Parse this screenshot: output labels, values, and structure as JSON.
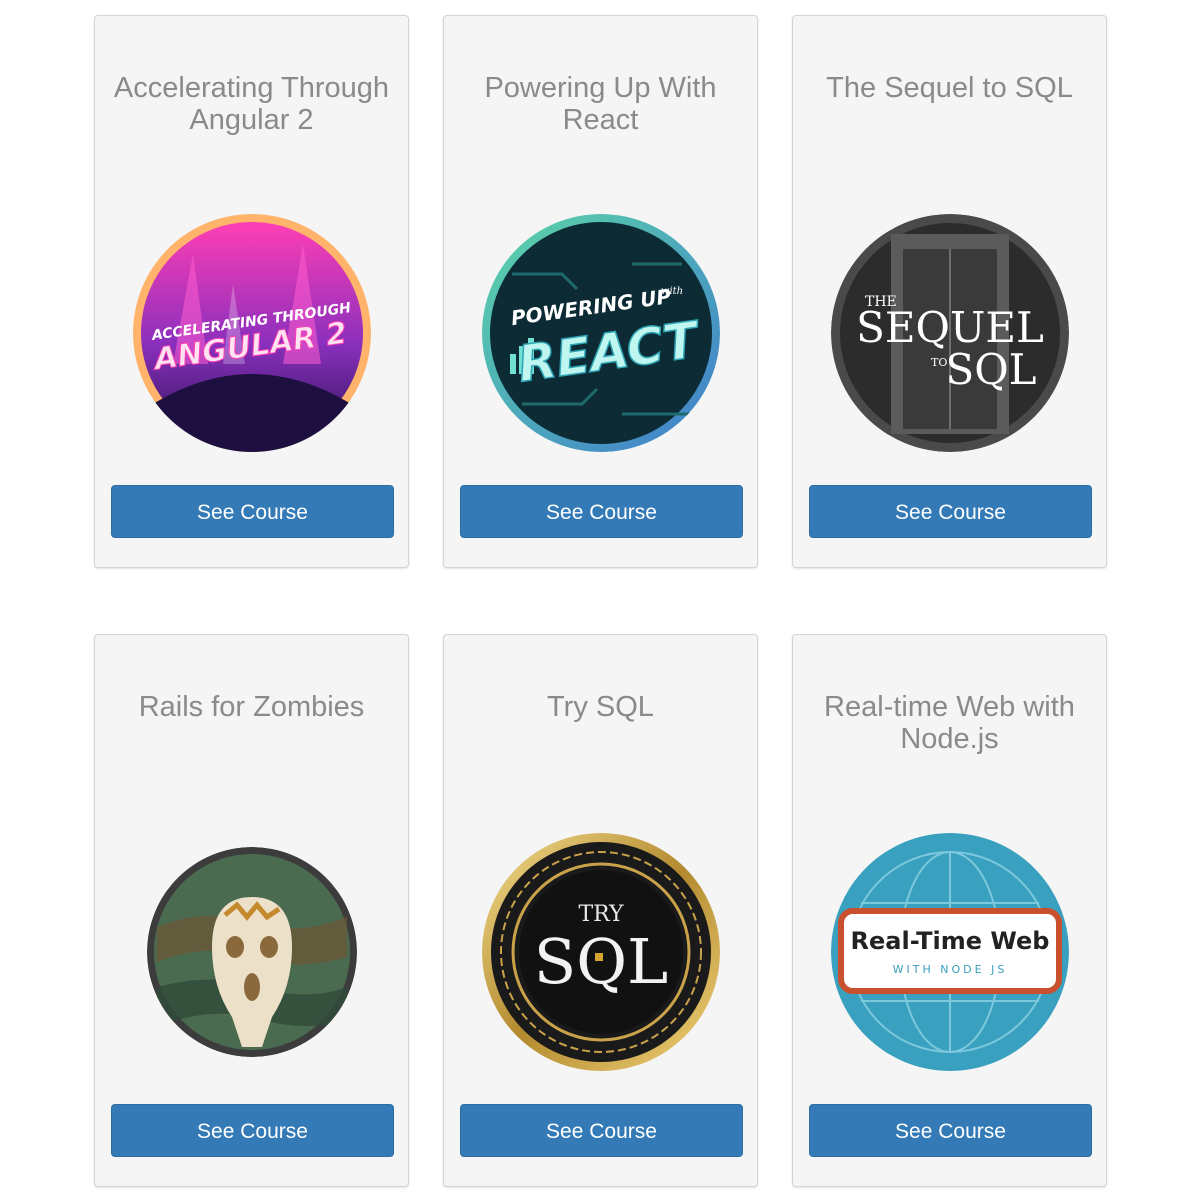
{
  "courses": [
    {
      "title": "Accelerating Through Angular 2",
      "button_label": "See Course",
      "badge": {
        "top_text": "ACCELERATING THROUGH",
        "main_text": "ANGULAR 2"
      }
    },
    {
      "title": "Powering Up With React",
      "button_label": "See Course",
      "badge": {
        "top_text": "POWERING UP",
        "small_text": "with",
        "main_text": "REACT"
      }
    },
    {
      "title": "The Sequel to SQL",
      "button_label": "See Course",
      "badge": {
        "small_text": "THE",
        "main_text": "SEQUEL",
        "sub_text": "TO",
        "end_text": "SQL"
      }
    },
    {
      "title": "Rails for Zombies",
      "button_label": "See Course"
    },
    {
      "title": "Try SQL",
      "button_label": "See Course",
      "badge": {
        "top_text": "TRY",
        "main_text": "SQL"
      }
    },
    {
      "title": "Real-time Web with Node.js",
      "button_label": "See Course",
      "badge": {
        "main_text": "Real-Time Web",
        "sub_text": "WITH NODE JS"
      }
    }
  ],
  "colors": {
    "button": "#337ab7",
    "card_bg": "#f5f5f5",
    "title": "#8a8a8a"
  }
}
